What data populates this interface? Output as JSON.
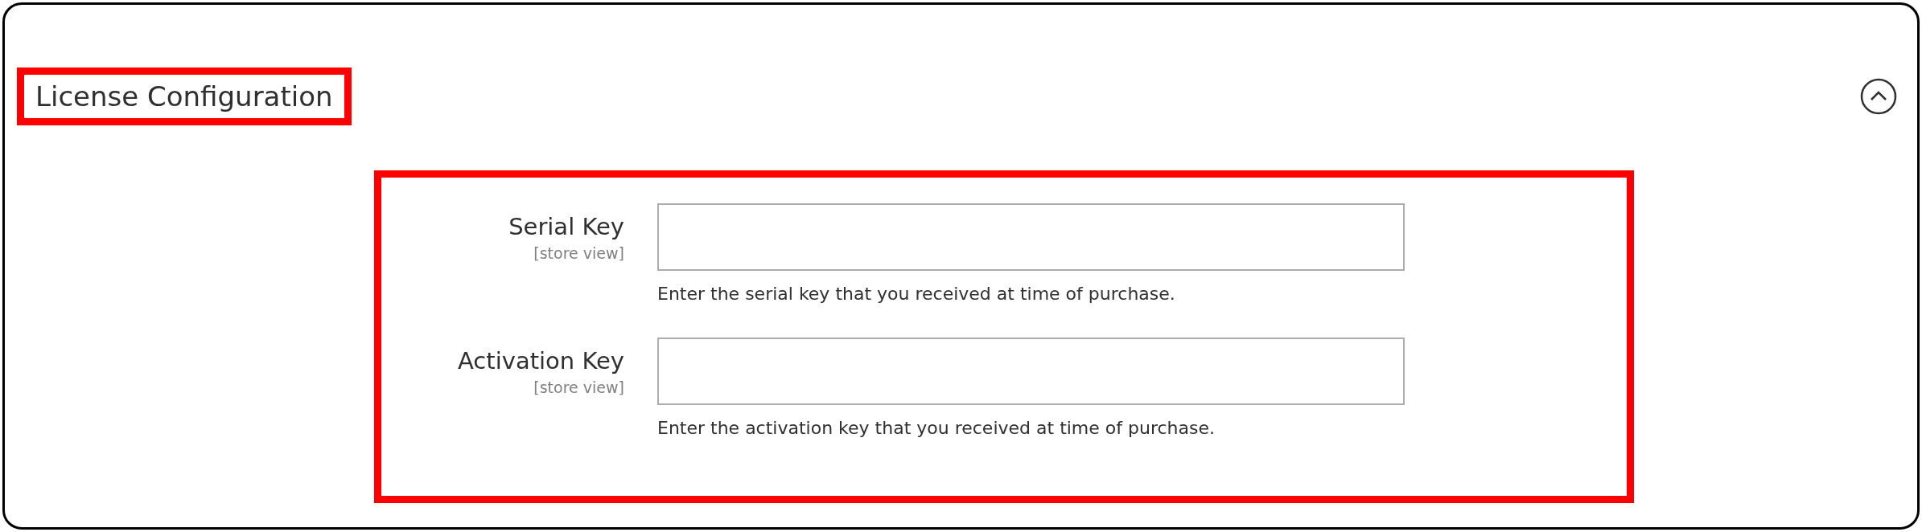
{
  "section": {
    "title": "License Configuration",
    "expanded": true
  },
  "fields": [
    {
      "label": "Serial Key",
      "scope": "[store view]",
      "note": "Enter the serial key that you received at time of purchase."
    },
    {
      "label": "Activation Key",
      "scope": "[store view]",
      "note": "Enter the activation key that you received at time of purchase."
    }
  ]
}
